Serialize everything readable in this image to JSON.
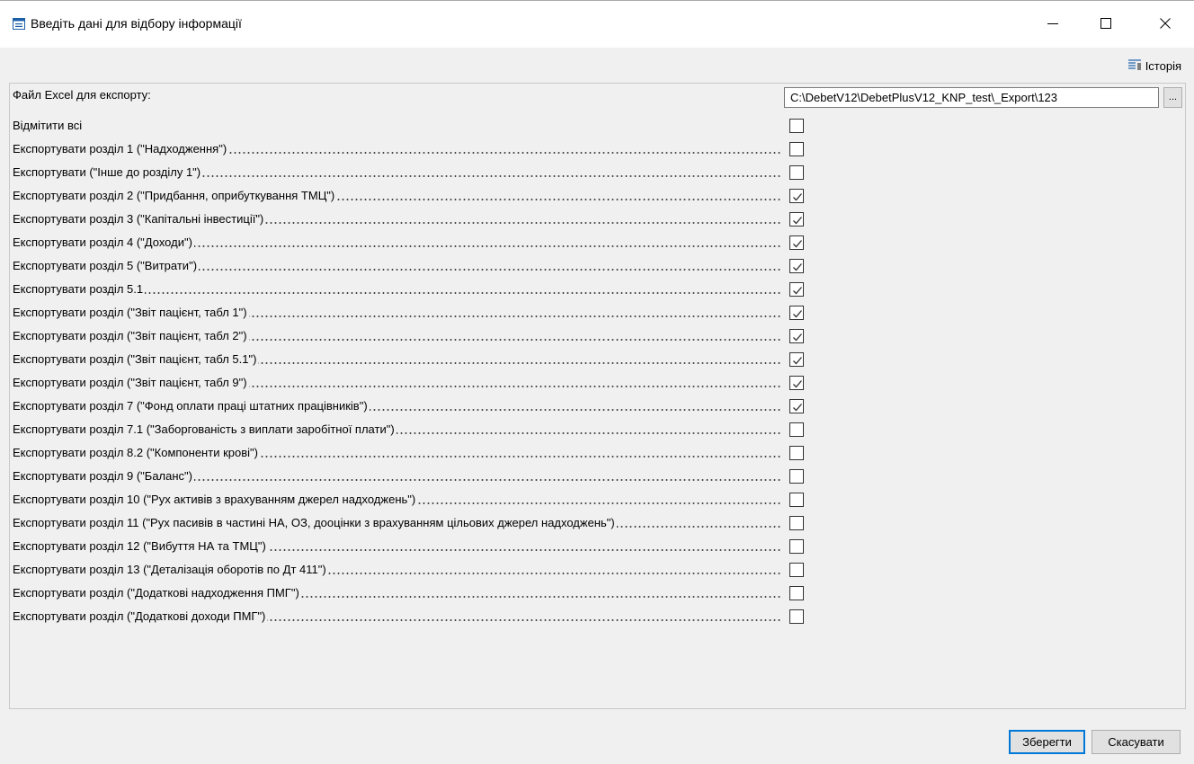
{
  "window": {
    "title": "Введіть дані для відбору інформації"
  },
  "toolbar": {
    "history_label": "Історія"
  },
  "file_export": {
    "label": "Файл Excel для експорту:",
    "value": "C:\\DebetV12\\DebetPlusV12_KNP_test\\_Export\\123",
    "browse_label": "..."
  },
  "select_all": {
    "label": "Відмітити всі",
    "checked": false
  },
  "sections": [
    {
      "label": "Експортувати розділ 1 (\"Надходження\")",
      "checked": false
    },
    {
      "label": "Експортувати (\"Інше до розділу 1\")",
      "checked": false
    },
    {
      "label": "Експортувати розділ 2 (\"Придбання, оприбуткування ТМЦ\")",
      "checked": true
    },
    {
      "label": "Експортувати розділ 3 (\"Капітальні інвестиції\")",
      "checked": true
    },
    {
      "label": "Експортувати розділ 4 (\"Доходи\")",
      "checked": true
    },
    {
      "label": "Експортувати розділ 5 (\"Витрати\")",
      "checked": true
    },
    {
      "label": "Експортувати розділ 5.1",
      "checked": true
    },
    {
      "label": "Експортувати розділ (\"Звіт пацієнт, табл 1\")",
      "checked": true
    },
    {
      "label": "Експортувати розділ (\"Звіт пацієнт, табл 2\")",
      "checked": true
    },
    {
      "label": "Експортувати розділ (\"Звіт пацієнт, табл 5.1\")",
      "checked": true
    },
    {
      "label": "Експортувати розділ (\"Звіт пацієнт, табл 9\")",
      "checked": true
    },
    {
      "label": "Експортувати розділ 7 (\"Фонд оплати праці штатних працівників\")",
      "checked": true
    },
    {
      "label": "Експортувати розділ 7.1 (\"Заборгованість з виплати заробітної плати\")",
      "checked": false
    },
    {
      "label": "Експортувати розділ 8.2 (\"Компоненти крові\")",
      "checked": false
    },
    {
      "label": "Експортувати розділ 9 (\"Баланс\")",
      "checked": false
    },
    {
      "label": "Експортувати розділ 10 (\"Рух активів з врахуванням джерел надходжень\")",
      "checked": false
    },
    {
      "label": "Експортувати розділ 11 (\"Рух пасивів в частині НА, ОЗ, дооцінки з врахуванням цільових джерел надходжень\")",
      "checked": false
    },
    {
      "label": "Експортувати розділ 12 (\"Вибуття НА та ТМЦ\")",
      "checked": false
    },
    {
      "label": "Експортувати розділ 13 (\"Деталізація оборотів по Дт 411\")",
      "checked": false
    },
    {
      "label": "Експортувати розділ (\"Додаткові надходження ПМГ\")",
      "checked": false
    },
    {
      "label": "Експортувати розділ (\"Додаткові доходи ПМГ\")",
      "checked": false
    }
  ],
  "buttons": {
    "save": "Зберегти",
    "cancel": "Скасувати"
  },
  "colors": {
    "accent": "#0078d7",
    "background": "#f0f0f0"
  },
  "icons": {
    "app": "window-form-icon",
    "history": "history-list-icon",
    "minimize": "minimize-icon",
    "maximize": "maximize-icon",
    "close": "close-icon",
    "checkmark": "checkmark-icon"
  }
}
